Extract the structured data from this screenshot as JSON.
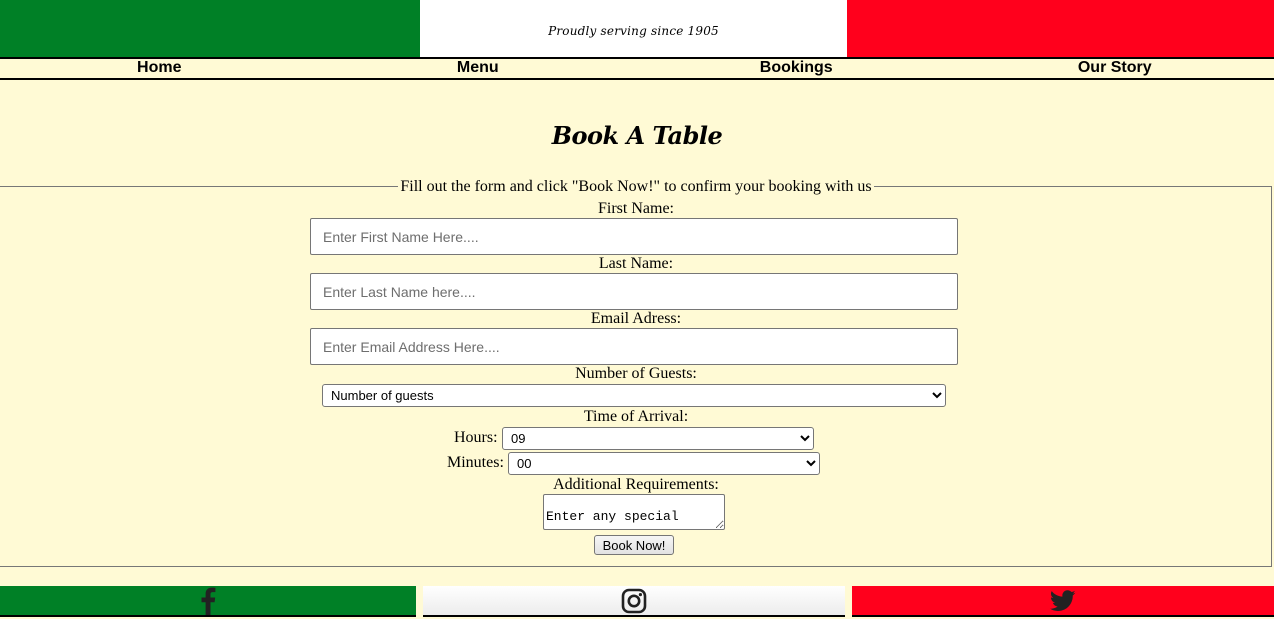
{
  "header": {
    "tagline": "Proudly serving since 1905",
    "colors": {
      "green": "#008026",
      "white": "#ffffff",
      "red": "#ff001c"
    }
  },
  "nav": {
    "items": [
      {
        "label": "Home"
      },
      {
        "label": "Menu"
      },
      {
        "label": "Bookings"
      },
      {
        "label": "Our Story"
      }
    ]
  },
  "page": {
    "title": "Book A Table",
    "background": "#fffad5"
  },
  "form": {
    "legend": "Fill out the form and click \"Book Now!\" to confirm your booking with us",
    "first_name": {
      "label": "First Name:",
      "placeholder": "Enter First Name Here...."
    },
    "last_name": {
      "label": "Last Name:",
      "placeholder": "Enter Last Name here...."
    },
    "email": {
      "label": "Email Adress:",
      "placeholder": "Enter Email Address Here...."
    },
    "guests": {
      "label": "Number of Guests:",
      "selected": "Number of guests"
    },
    "arrival": {
      "label": "Time of Arrival:",
      "hours_label": "Hours:",
      "hours_selected": "09",
      "minutes_label": "Minutes:",
      "minutes_selected": "00"
    },
    "requirements": {
      "label": "Additional Requirements:",
      "placeholder": "Enter any special"
    },
    "submit_label": "Book Now!"
  },
  "footer": {
    "icons": [
      "facebook-icon",
      "instagram-icon",
      "twitter-icon"
    ]
  }
}
